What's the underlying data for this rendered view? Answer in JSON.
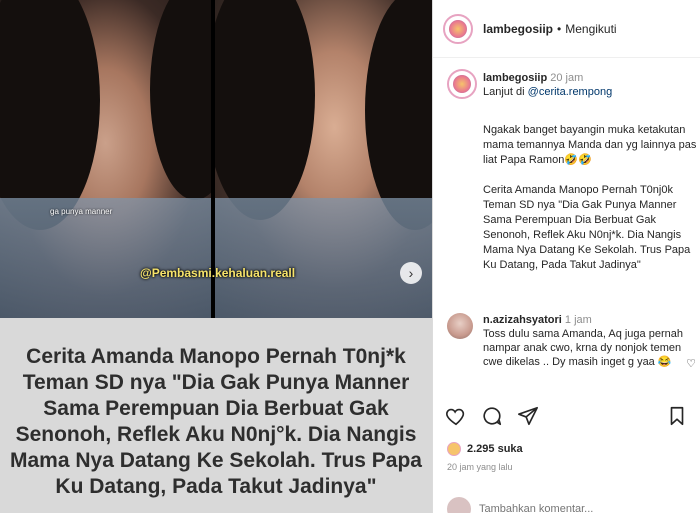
{
  "media": {
    "mini_caption": "ga punya manner",
    "watermark": "@Pembasmi.kehaluan.reall",
    "text_card": "Cerita Amanda Manopo Pernah T0nj*k Teman SD nya \"Dia Gak Punya Manner Sama Perempuan Dia Berbuat Gak Senonoh, Reflek Aku N0nj°k. Dia Nangis Mama Nya Datang Ke Sekolah. Trus Papa Ku Datang, Pada Takut Jadinya\""
  },
  "header": {
    "username": "lambegosiip",
    "separator": "•",
    "follow_state": "Mengikuti"
  },
  "post": {
    "username": "lambegosiip",
    "time": "20 jam",
    "lead": "Lanjut di",
    "link": "@cerita.rempong",
    "caption1": "Ngakak banget bayangin muka ketakutan mama temannya Manda dan yg lainnya pas liat Papa Ramon🤣🤣",
    "caption2": "Cerita Amanda Manopo Pernah T0nj0k Teman SD nya \"Dia Gak Punya Manner Sama Perempuan Dia Berbuat Gak Senonoh, Reflek Aku N0nj*k. Dia Nangis Mama Nya Datang Ke Sekolah. Trus Papa Ku Datang, Pada Takut Jadinya\""
  },
  "comment": {
    "username": "n.azizahsyatori",
    "time": "1 jam",
    "text": "Toss dulu sama Amanda, Aq juga pernah nampar anak cwo, krna dy nonjok temen cwe dikelas .. Dy masih inget g yaa 😂"
  },
  "stats": {
    "likes": "2.295 suka",
    "posted": "20 jam yang lalu"
  },
  "add_comment": {
    "placeholder": "Tambahkan komentar..."
  }
}
